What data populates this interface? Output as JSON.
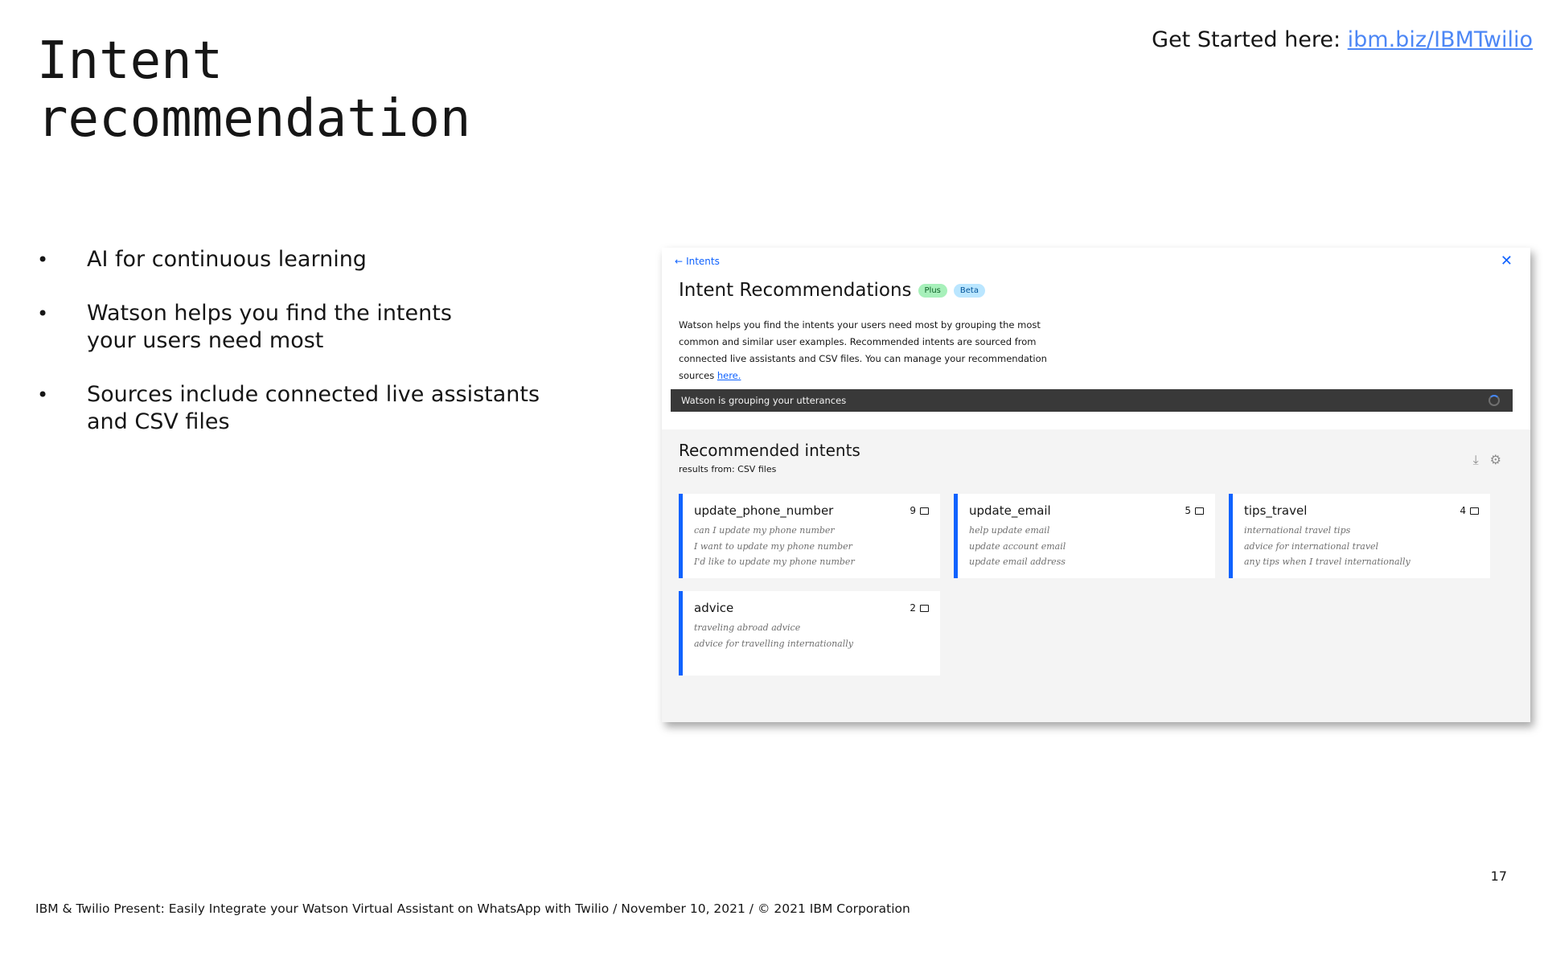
{
  "slide": {
    "title_line1": "Intent",
    "title_line2": "recommendation",
    "get_started_label": "Get Started here: ",
    "get_started_link": "ibm.biz/IBMTwilio",
    "bullets": [
      {
        "line1": "AI for continuous learning",
        "line2": ""
      },
      {
        "line1": "Watson helps you find the intents",
        "line2": "your users need most"
      },
      {
        "line1": "Sources include connected live assistants",
        "line2": "and CSV files"
      }
    ],
    "page_number": "17",
    "footer": "IBM & Twilio Present: Easily Integrate your Watson Virtual Assistant on WhatsApp with Twilio / November 10, 2021 / © 2021 IBM Corporation"
  },
  "panel": {
    "back_link": "Intents",
    "title": "Intent Recommendations",
    "tag_plus": "Plus",
    "tag_beta": "Beta",
    "description": "Watson helps you find the intents your users need most by grouping the most common and similar user examples. Recommended intents are sourced from connected live assistants and CSV files. You can manage your recommendation sources ",
    "description_link": "here.",
    "notification": "Watson is grouping your utterances",
    "recommended_title": "Recommended intents",
    "results_from": "results from: CSV files",
    "cards": [
      {
        "name": "update_phone_number",
        "count": "9",
        "examples": [
          "can I update my phone number",
          "I want to update my phone number",
          "I'd like to update my phone number"
        ]
      },
      {
        "name": "update_email",
        "count": "5",
        "examples": [
          "help update email",
          "update account email",
          "update email address"
        ]
      },
      {
        "name": "tips_travel",
        "count": "4",
        "examples": [
          "international travel tips",
          "advice for international travel",
          "any tips when I travel internationally"
        ]
      },
      {
        "name": "advice",
        "count": "2",
        "examples": [
          "traveling abroad advice",
          "advice for travelling internationally",
          ""
        ]
      }
    ]
  },
  "colors": {
    "accent": "#0f62fe",
    "link": "#4d87f5",
    "notification_bg": "#393939",
    "panel_gray": "#f4f4f4"
  },
  "icons": [
    "arrow-left-icon",
    "close-icon",
    "loading-spinner-icon",
    "download-icon",
    "settings-adjust-icon",
    "chat-bubble-icon"
  ]
}
